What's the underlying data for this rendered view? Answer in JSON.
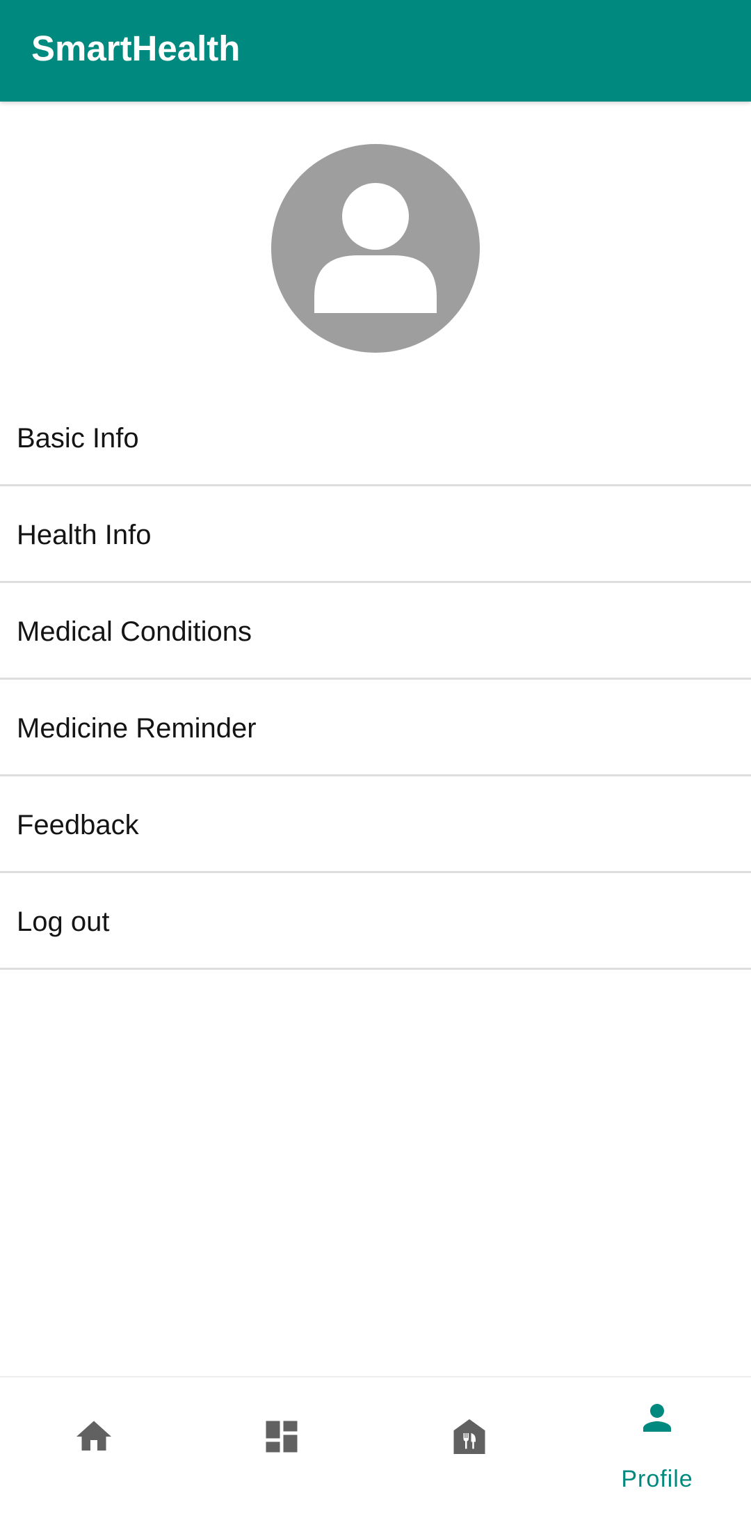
{
  "app": {
    "title": "SmartHealth",
    "accent_color": "#00897f"
  },
  "profile": {
    "avatar_icon": "person-placeholder-icon"
  },
  "menu": {
    "items": [
      {
        "label": "Basic Info"
      },
      {
        "label": "Health Info"
      },
      {
        "label": "Medical Conditions"
      },
      {
        "label": "Medicine Reminder"
      },
      {
        "label": "Feedback"
      },
      {
        "label": "Log out"
      }
    ]
  },
  "bottom_nav": {
    "items": [
      {
        "icon": "home-icon",
        "label": "",
        "selected": false
      },
      {
        "icon": "dashboard-icon",
        "label": "",
        "selected": false
      },
      {
        "icon": "restaurant-icon",
        "label": "",
        "selected": false
      },
      {
        "icon": "person-icon",
        "label": "Profile",
        "selected": true
      }
    ],
    "selected_color": "#00897f",
    "unselected_color": "#616161"
  }
}
